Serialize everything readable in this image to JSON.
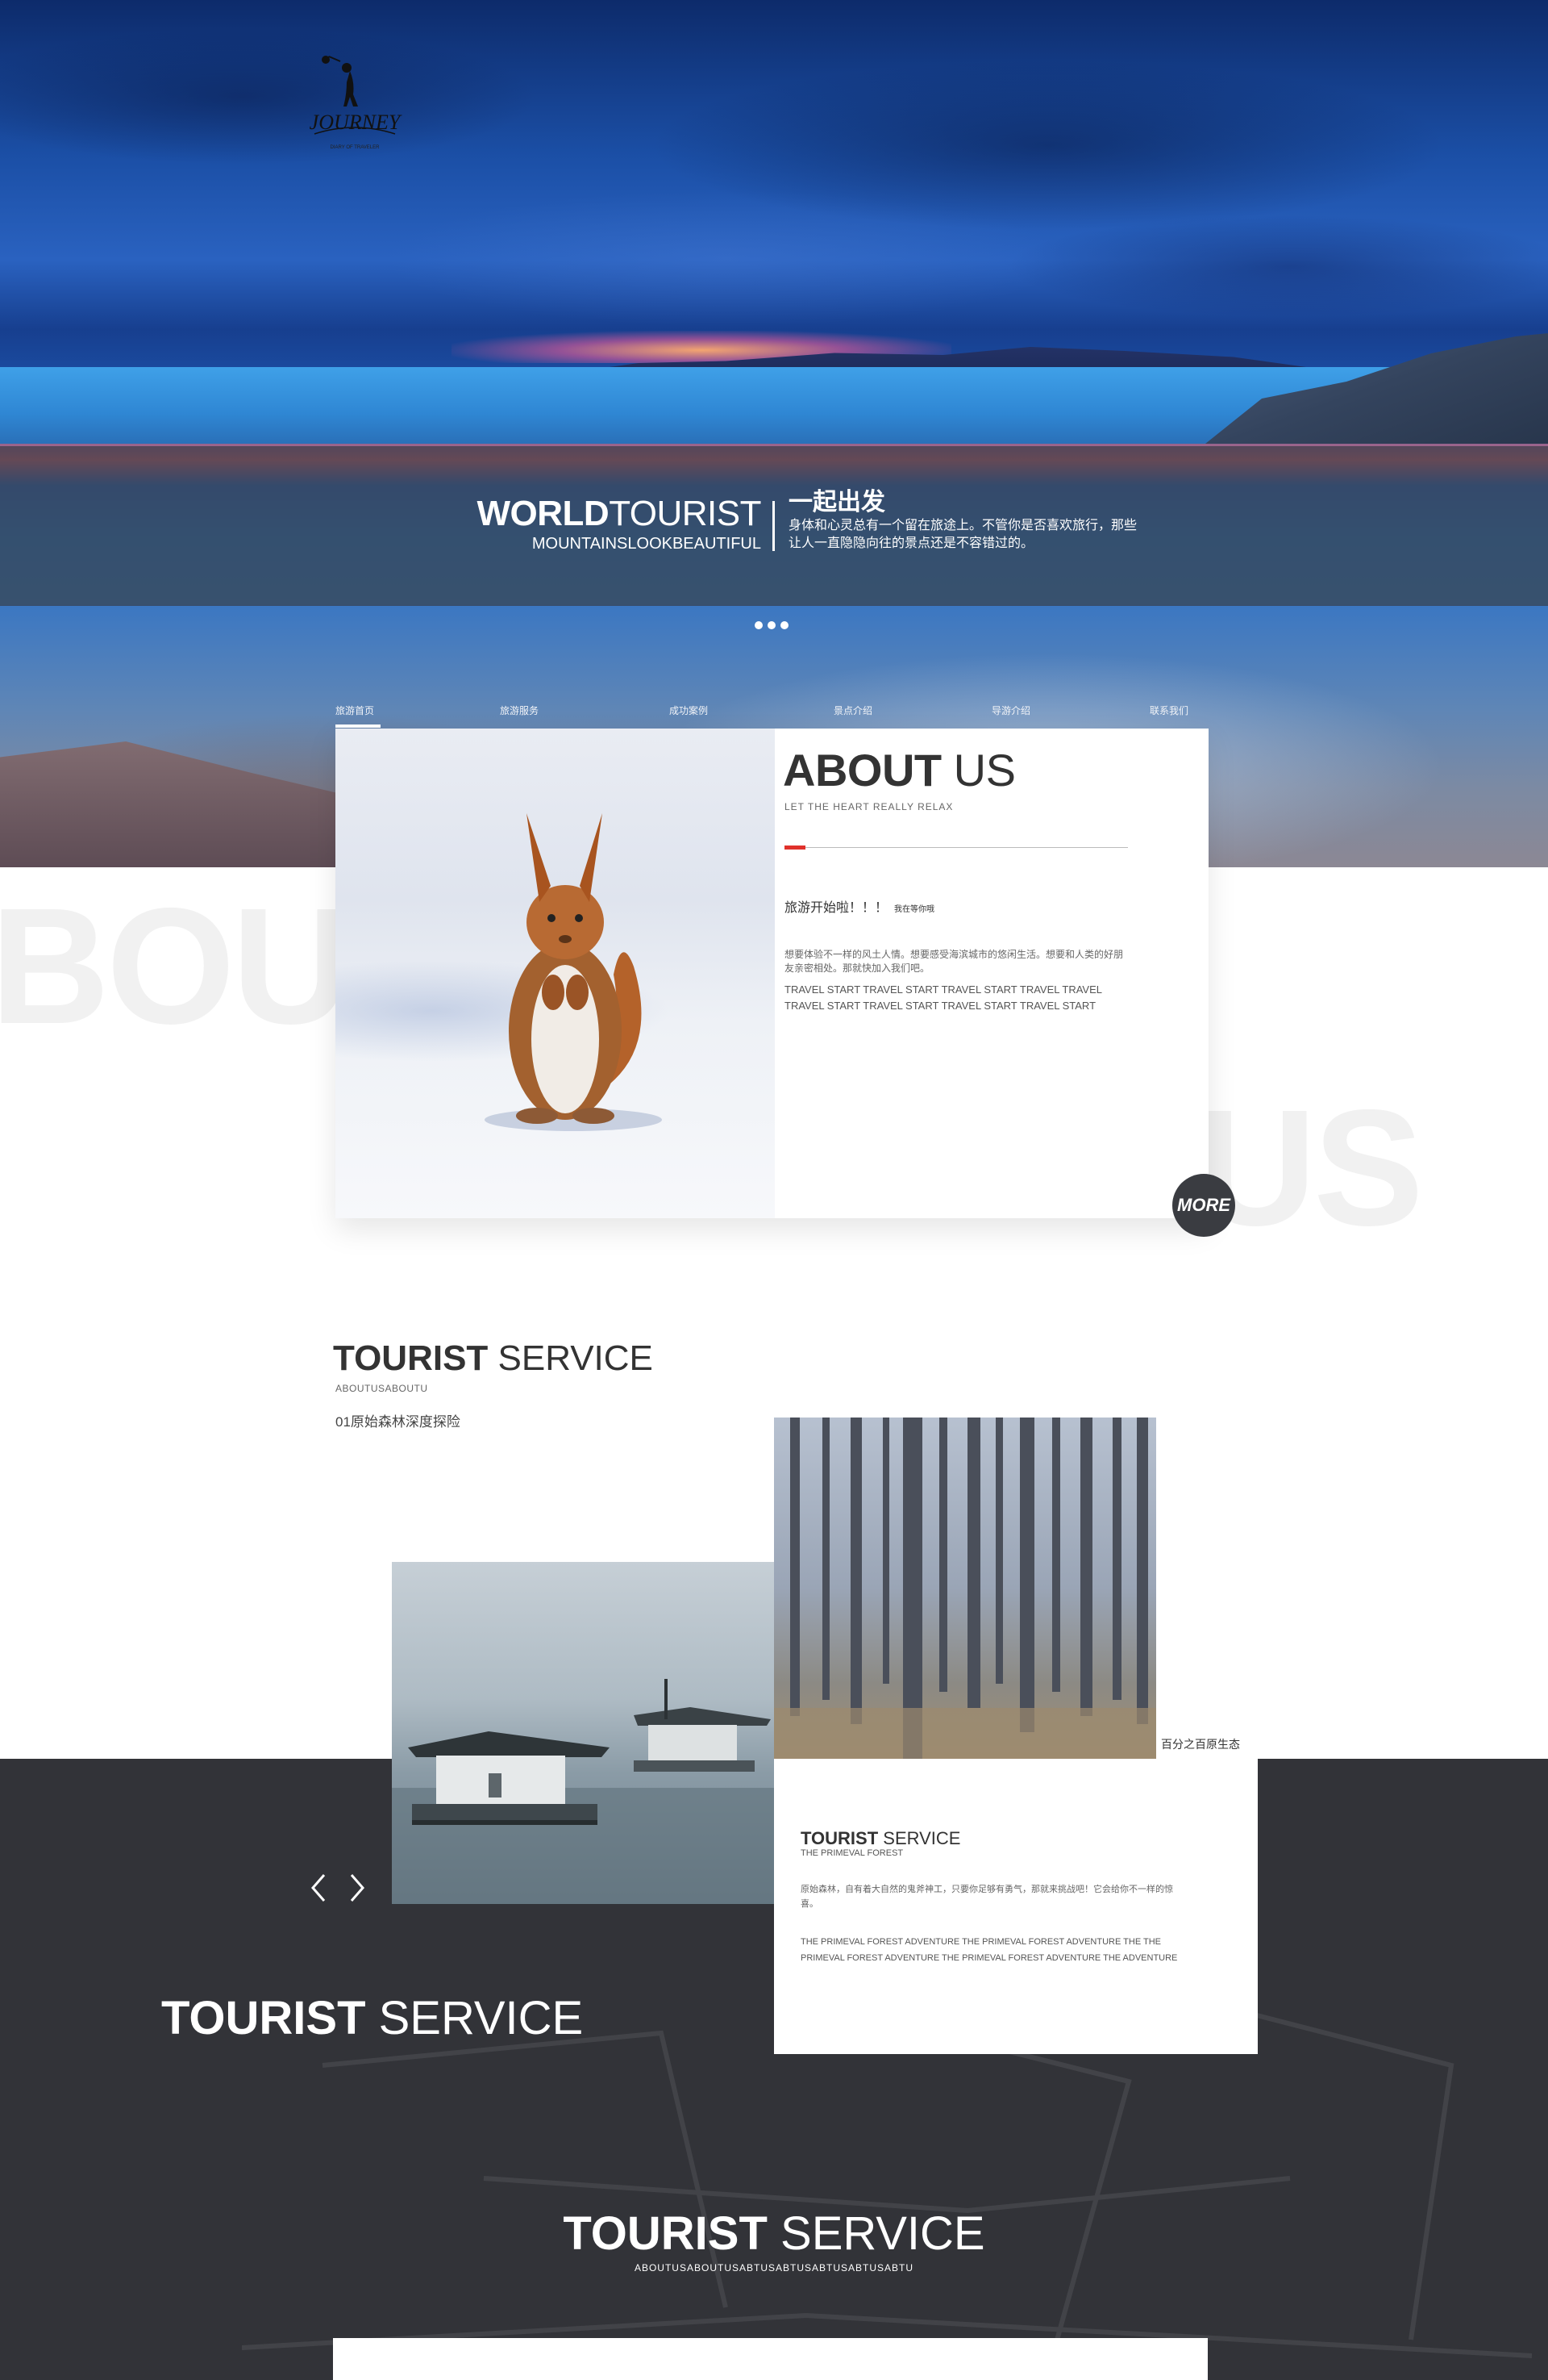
{
  "brand": {
    "logo_text": "JOURNEY",
    "logo_tagline": "DIARY OF TRAVELER"
  },
  "slogan": {
    "title_bold": "WORLD",
    "title_light": "TOURIST",
    "subtitle": "MOUNTAINSLOOKBEAUTIFUL",
    "cn_title": "一起出发",
    "cn_text": "身体和心灵总有一个留在旅途上。不管你是否喜欢旅行，那些让人一直隐隐向往的景点还是不容错过的。"
  },
  "nav": {
    "items": [
      {
        "label": "旅游首页",
        "active": true
      },
      {
        "label": "旅游服务",
        "active": false
      },
      {
        "label": "成功案例",
        "active": false
      },
      {
        "label": "景点介绍",
        "active": false
      },
      {
        "label": "导游介绍",
        "active": false
      },
      {
        "label": "联系我们",
        "active": false
      }
    ]
  },
  "background_words": {
    "left": "BOUT",
    "right": "US"
  },
  "about": {
    "title_bold": "ABOUT",
    "title_light": " US",
    "subtitle": "LET THE HEART REALLY RELAX",
    "heading": "旅游开始啦！！！",
    "heading_small": "我在等你哦",
    "text_cn": "想要体验不一样的风土人情。想要感受海滨城市的悠闲生活。想要和人类的好朋友亲密相处。那就快加入我们吧。",
    "text_en": "TRAVEL START TRAVEL START TRAVEL START TRAVEL TRAVEL TRAVEL START TRAVEL START TRAVEL START TRAVEL START",
    "more_label": "MORE",
    "accent_color": "#e0312b"
  },
  "tourist_service": {
    "title_bold": "TOURIST",
    "title_light": " SERVICE",
    "subtitle": "ABOUTUSABOUTU",
    "item": "01原始森林深度探险",
    "forest_caption": "百分之百原生态",
    "card": {
      "title_bold": "TOURIST",
      "title_light": " SERVICE",
      "subtitle": "THE PRIMEVAL FOREST",
      "text_cn": "原始森林，自有着大自然的鬼斧神工，只要你足够有勇气，那就来挑战吧！它会给你不一样的惊喜。",
      "text_en": "THE PRIMEVAL FOREST ADVENTURE THE PRIMEVAL FOREST ADVENTURE THE THE PRIMEVAL FOREST ADVENTURE THE PRIMEVAL FOREST ADVENTURE THE ADVENTURE"
    }
  },
  "dark_section": {
    "title1_bold": "TOURIST",
    "title1_light": " SERVICE",
    "title2_bold": "TOURIST",
    "title2_light": " SERVICE",
    "subtitle2": "ABOUTUSABOUTUSABTUSABTUSABTUSABTUSABTU",
    "background_color": "#323338"
  }
}
